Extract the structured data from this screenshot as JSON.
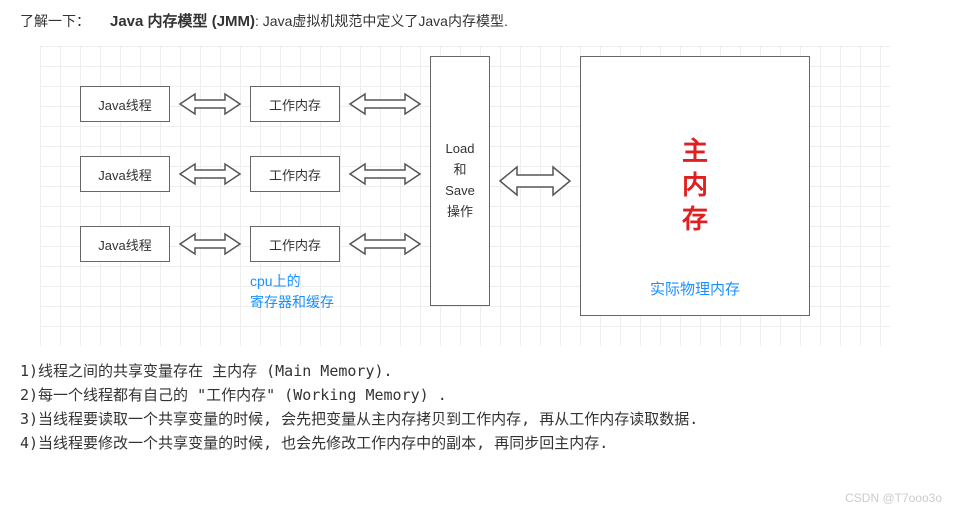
{
  "header": {
    "label": "了解一下：",
    "title": "Java 内存模型 (JMM)",
    "desc": ": Java虚拟机规范中定义了Java内存模型."
  },
  "diagram": {
    "java_thread": "Java线程",
    "work_memory": "工作内存",
    "load_save": "Load\n和\nSave\n操作",
    "main_memory": "主\n内\n存",
    "cpu_caption_l1": "cpu上的",
    "cpu_caption_l2": "寄存器和缓存",
    "main_mem_caption": "实际物理内存"
  },
  "notes": {
    "n1": "1)线程之间的共享变量存在 主内存 (Main Memory).",
    "n2": "2)每一个线程都有自己的 \"工作内存\" (Working Memory) .",
    "n3": "3)当线程要读取一个共享变量的时候, 会先把变量从主内存拷贝到工作内存, 再从工作内存读取数据.",
    "n4": "4)当线程要修改一个共享变量的时候, 也会先修改工作内存中的副本, 再同步回主内存."
  },
  "watermark": "CSDN @T7ooo3o"
}
